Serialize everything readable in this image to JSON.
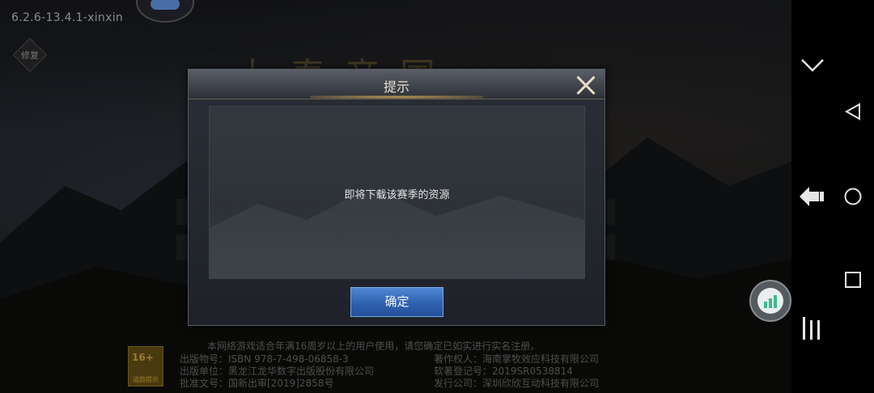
{
  "game": {
    "version": "6.2.6-13.4.1-xinxin",
    "repair_label": "修复",
    "logo_title": "大秦帝国",
    "age_badge": {
      "number": "16+",
      "label": "适龄提示"
    },
    "footer": {
      "notice": "本网络游戏适合年满16周岁以上的用户使用，请您确定已如实进行实名注册。",
      "left_lines": [
        "出版物号：ISBN 978-7-498-06858-3",
        "出版单位：黑龙江龙华数字出版股份有限公司",
        "批准文号：国新出审[2019]2858号"
      ],
      "right_lines": [
        "著作权人：海南掌牧效应科技有限公司",
        "软著登记号：2019SR0538814",
        "发行公司：深圳欣欣互动科技有限公司"
      ]
    }
  },
  "dialog": {
    "title": "提示",
    "message": "即将下载该赛季的资源",
    "confirm_label": "确定"
  },
  "nav": {
    "icons": [
      "collapse-chevron-icon",
      "back-triangle-icon",
      "home-circle-icon",
      "recent-square-icon",
      "menu-bars-icon",
      "gesture-arrow-icon",
      "signal-bars-icon"
    ]
  },
  "colors": {
    "accent_blue": "#2f62b0",
    "panel_bg": "#2d3238",
    "title_glow": "#d2aa5a",
    "float_green": "#3cb98a"
  }
}
